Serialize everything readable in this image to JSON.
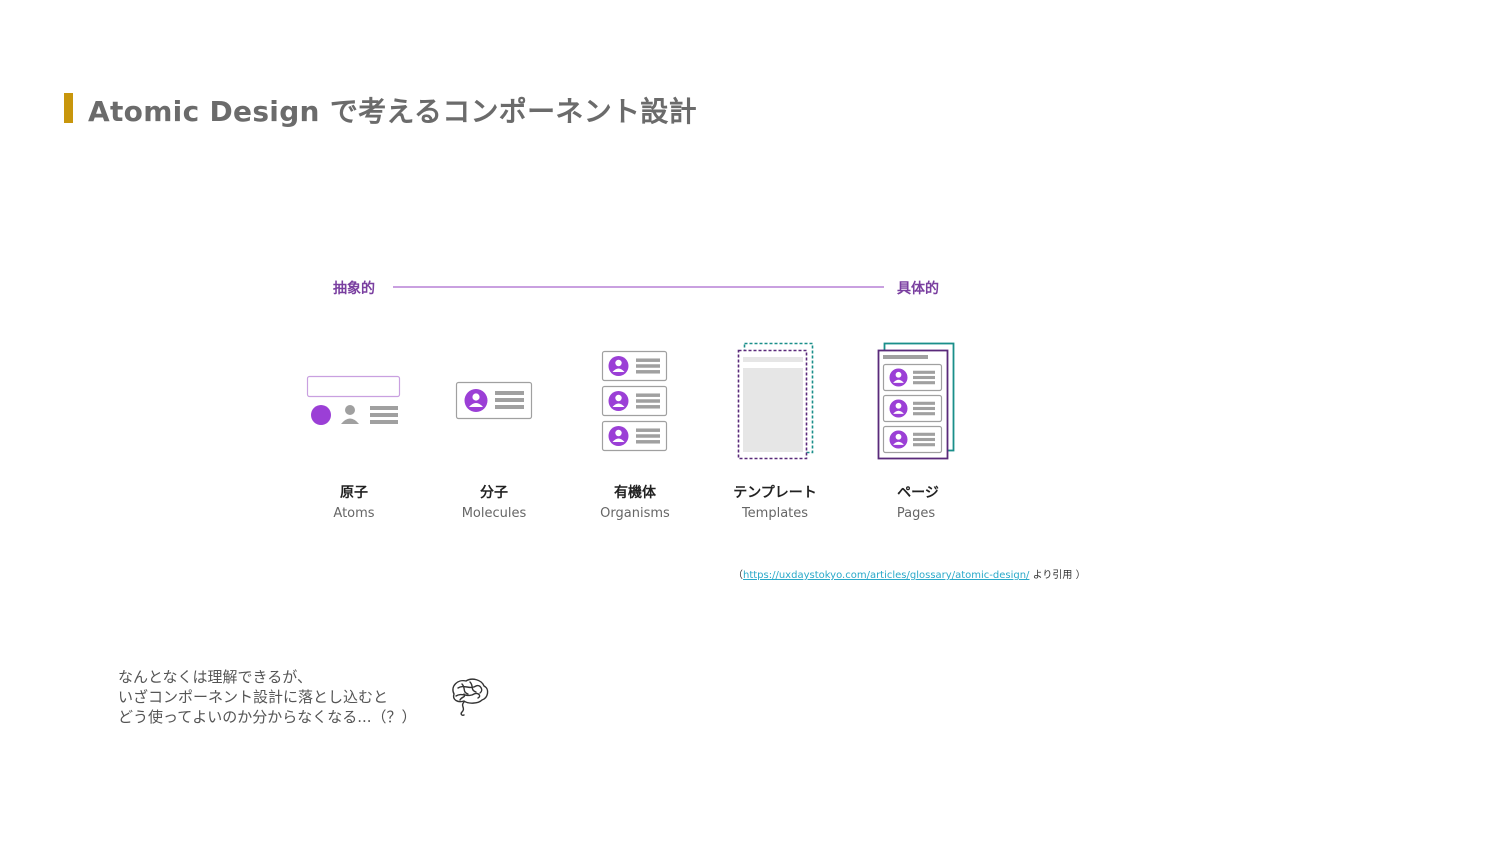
{
  "title": "Atomic Design で考えるコンポーネント設計",
  "colors": {
    "accent": "#c8960c",
    "purple": "#9b3fd6",
    "dark_purple": "#5a2a7a",
    "teal": "#1a8f8a",
    "gray": "#a0a0a0",
    "axis_text": "#7a3fa0",
    "axis_line": "#c9a0e0"
  },
  "axis": {
    "left_label": "抽象的",
    "right_label": "具体的"
  },
  "stages": [
    {
      "jp": "原子",
      "en": "Atoms",
      "icon": "atoms-icon"
    },
    {
      "jp": "分子",
      "en": "Molecules",
      "icon": "molecules-icon"
    },
    {
      "jp": "有機体",
      "en": "Organisms",
      "icon": "organisms-icon"
    },
    {
      "jp": "テンプレート",
      "en": "Templates",
      "icon": "templates-icon"
    },
    {
      "jp": "ページ",
      "en": "Pages",
      "icon": "pages-icon"
    }
  ],
  "citation": {
    "open": "（",
    "url": "https://uxdaystokyo.com/articles/glossary/atomic-design/",
    "suffix": "より引用 ）"
  },
  "comment": {
    "line1": "なんとなくは理解できるが、",
    "line2": "いざコンポーネント設計に落とし込むと",
    "line3": "どう使ってよいのか分からなくなる...（？）"
  }
}
